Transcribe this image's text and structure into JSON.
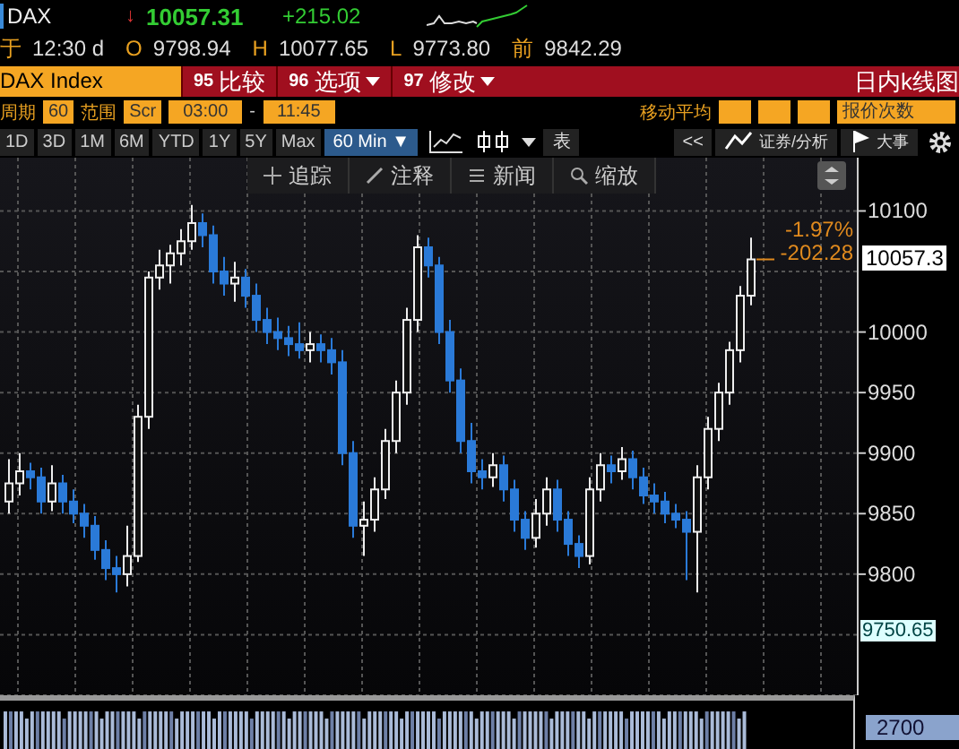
{
  "quote": {
    "symbol": "DAX",
    "arrow": "↓",
    "last": "10057.31",
    "change": "+215.02"
  },
  "ohlc": [
    {
      "label": "于",
      "value": "12:30 d"
    },
    {
      "label": "O",
      "value": "9798.94"
    },
    {
      "label": "H",
      "value": "10077.65"
    },
    {
      "label": "L",
      "value": "9773.80"
    },
    {
      "label": "前",
      "value": "9842.29"
    }
  ],
  "security_bar": {
    "ticker": "DAX Index",
    "menus": [
      {
        "code": "95",
        "label": "比较",
        "dropdown": false
      },
      {
        "code": "96",
        "label": "选项",
        "dropdown": true
      },
      {
        "code": "97",
        "label": "修改",
        "dropdown": true
      }
    ],
    "title": "日内k线图"
  },
  "settings": {
    "period_label": "周期",
    "period": "60",
    "range_label": "范围",
    "range": "Scr",
    "start": "03:00",
    "separator": "-",
    "end": "11:45",
    "ma_label": "移动平均",
    "ticks_label": "报价次数"
  },
  "toolbar": {
    "ranges": [
      {
        "label": "1D",
        "selected": false
      },
      {
        "label": "3D",
        "selected": false
      },
      {
        "label": "1M",
        "selected": false
      },
      {
        "label": "6M",
        "selected": false
      },
      {
        "label": "YTD",
        "selected": false
      },
      {
        "label": "1Y",
        "selected": false
      },
      {
        "label": "5Y",
        "selected": false
      },
      {
        "label": "Max",
        "selected": false
      },
      {
        "label": "60 Min ▼",
        "selected": true
      }
    ],
    "table_label": "表",
    "back": "<<",
    "analysis_label": "证券/分析",
    "events_label": "大事"
  },
  "chart": {
    "tools": [
      "追踪",
      "注释",
      "新闻",
      "缩放"
    ],
    "last_price": "10057.3",
    "change_pct": "-1.97%",
    "change_abs": "-202.28",
    "low_marker": "9750.65",
    "volume_label": "2700",
    "chart_data": {
      "type": "candlestick",
      "grid": true,
      "ylim": [
        9700,
        10144
      ],
      "yticks": [
        10100,
        10000,
        9950,
        9900,
        9850,
        9800
      ],
      "ohlc": [
        [
          9860,
          9895,
          9850,
          9875
        ],
        [
          9875,
          9900,
          9865,
          9885
        ],
        [
          9885,
          9892,
          9870,
          9880
        ],
        [
          9880,
          9888,
          9850,
          9860
        ],
        [
          9860,
          9890,
          9852,
          9875
        ],
        [
          9875,
          9882,
          9850,
          9860
        ],
        [
          9860,
          9870,
          9842,
          9850
        ],
        [
          9850,
          9858,
          9830,
          9840
        ],
        [
          9840,
          9848,
          9812,
          9820
        ],
        [
          9820,
          9828,
          9795,
          9805
        ],
        [
          9805,
          9815,
          9785,
          9800
        ],
        [
          9800,
          9840,
          9790,
          9815
        ],
        [
          9815,
          9940,
          9810,
          9930
        ],
        [
          9930,
          10050,
          9920,
          10045
        ],
        [
          10045,
          10068,
          10035,
          10055
        ],
        [
          10055,
          10072,
          10040,
          10065
        ],
        [
          10065,
          10085,
          10055,
          10075
        ],
        [
          10075,
          10105,
          10068,
          10090
        ],
        [
          10090,
          10098,
          10070,
          10080
        ],
        [
          10080,
          10088,
          10040,
          10050
        ],
        [
          10050,
          10062,
          10030,
          10040
        ],
        [
          10040,
          10058,
          10025,
          10045
        ],
        [
          10045,
          10052,
          10020,
          10030
        ],
        [
          10030,
          10040,
          10000,
          10010
        ],
        [
          10010,
          10020,
          9990,
          10000
        ],
        [
          10000,
          10012,
          9985,
          9995
        ],
        [
          9995,
          10005,
          9980,
          9990
        ],
        [
          9990,
          10008,
          9978,
          9985
        ],
        [
          9985,
          10000,
          9975,
          9990
        ],
        [
          9990,
          9998,
          9975,
          9985
        ],
        [
          9985,
          9995,
          9965,
          9975
        ],
        [
          9975,
          9985,
          9890,
          9900
        ],
        [
          9900,
          9910,
          9830,
          9840
        ],
        [
          9840,
          9860,
          9815,
          9845
        ],
        [
          9845,
          9880,
          9835,
          9870
        ],
        [
          9870,
          9920,
          9862,
          9910
        ],
        [
          9910,
          9960,
          9900,
          9950
        ],
        [
          9950,
          10020,
          9940,
          10010
        ],
        [
          10010,
          10080,
          10000,
          10070
        ],
        [
          10070,
          10078,
          10045,
          10055
        ],
        [
          10055,
          10062,
          9990,
          10000
        ],
        [
          10000,
          10010,
          9950,
          9960
        ],
        [
          9960,
          9970,
          9900,
          9910
        ],
        [
          9910,
          9925,
          9875,
          9885
        ],
        [
          9885,
          9895,
          9870,
          9880
        ],
        [
          9880,
          9900,
          9872,
          9890
        ],
        [
          9890,
          9898,
          9860,
          9870
        ],
        [
          9870,
          9878,
          9835,
          9845
        ],
        [
          9845,
          9852,
          9820,
          9830
        ],
        [
          9830,
          9862,
          9822,
          9850
        ],
        [
          9850,
          9880,
          9840,
          9870
        ],
        [
          9870,
          9878,
          9835,
          9845
        ],
        [
          9845,
          9852,
          9815,
          9825
        ],
        [
          9825,
          9832,
          9805,
          9815
        ],
        [
          9815,
          9880,
          9808,
          9870
        ],
        [
          9870,
          9900,
          9860,
          9890
        ],
        [
          9890,
          9898,
          9875,
          9885
        ],
        [
          9885,
          9905,
          9878,
          9895
        ],
        [
          9895,
          9902,
          9870,
          9880
        ],
        [
          9880,
          9888,
          9858,
          9865
        ],
        [
          9865,
          9875,
          9850,
          9860
        ],
        [
          9860,
          9868,
          9842,
          9850
        ],
        [
          9850,
          9858,
          9838,
          9845
        ],
        [
          9845,
          9852,
          9795,
          9835
        ],
        [
          9835,
          9890,
          9785,
          9880
        ],
        [
          9880,
          9930,
          9870,
          9920
        ],
        [
          9920,
          9958,
          9910,
          9950
        ],
        [
          9950,
          9992,
          9940,
          9985
        ],
        [
          9985,
          10038,
          9975,
          10030
        ],
        [
          10030,
          10078,
          10022,
          10060
        ]
      ]
    }
  }
}
